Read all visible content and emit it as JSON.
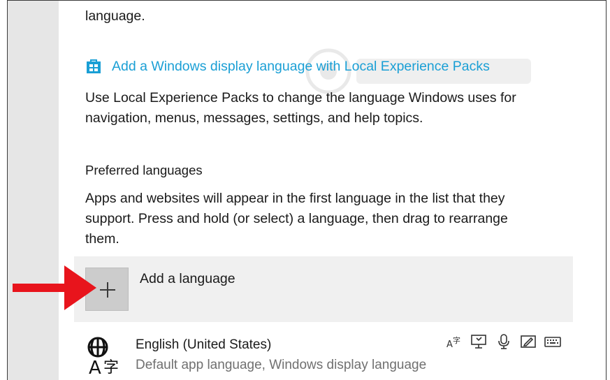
{
  "top_fragment": "language.",
  "display_pack_link": {
    "label": "Add a Windows display language with Local Experience Packs",
    "icon": "store-bag-icon"
  },
  "lep_description": {
    "line1": "Use Local Experience Packs to change the language Windows uses for",
    "line2": "navigation, menus, messages, settings, and help topics."
  },
  "preferred_languages": {
    "heading": "Preferred languages",
    "desc_line1": "Apps and websites will appear in the first language in the list that they",
    "desc_line2": "support. Press and hold (or select) a language, then drag to rearrange",
    "desc_line3": "them."
  },
  "add_language": {
    "label": "Add a language",
    "icon": "plus-icon"
  },
  "languages": [
    {
      "name": "English (United States)",
      "detail": "Default app language, Windows display language",
      "icon": "language-globe-icon",
      "features": [
        "language-pack-icon",
        "display-language-icon",
        "speech-icon",
        "handwriting-icon",
        "keyboard-icon"
      ]
    }
  ],
  "colors": {
    "link": "#1a9fd5",
    "annotation_arrow": "#e8141c",
    "add_row_bg": "#f0f0f0",
    "plus_box_bg": "#cccccc"
  }
}
